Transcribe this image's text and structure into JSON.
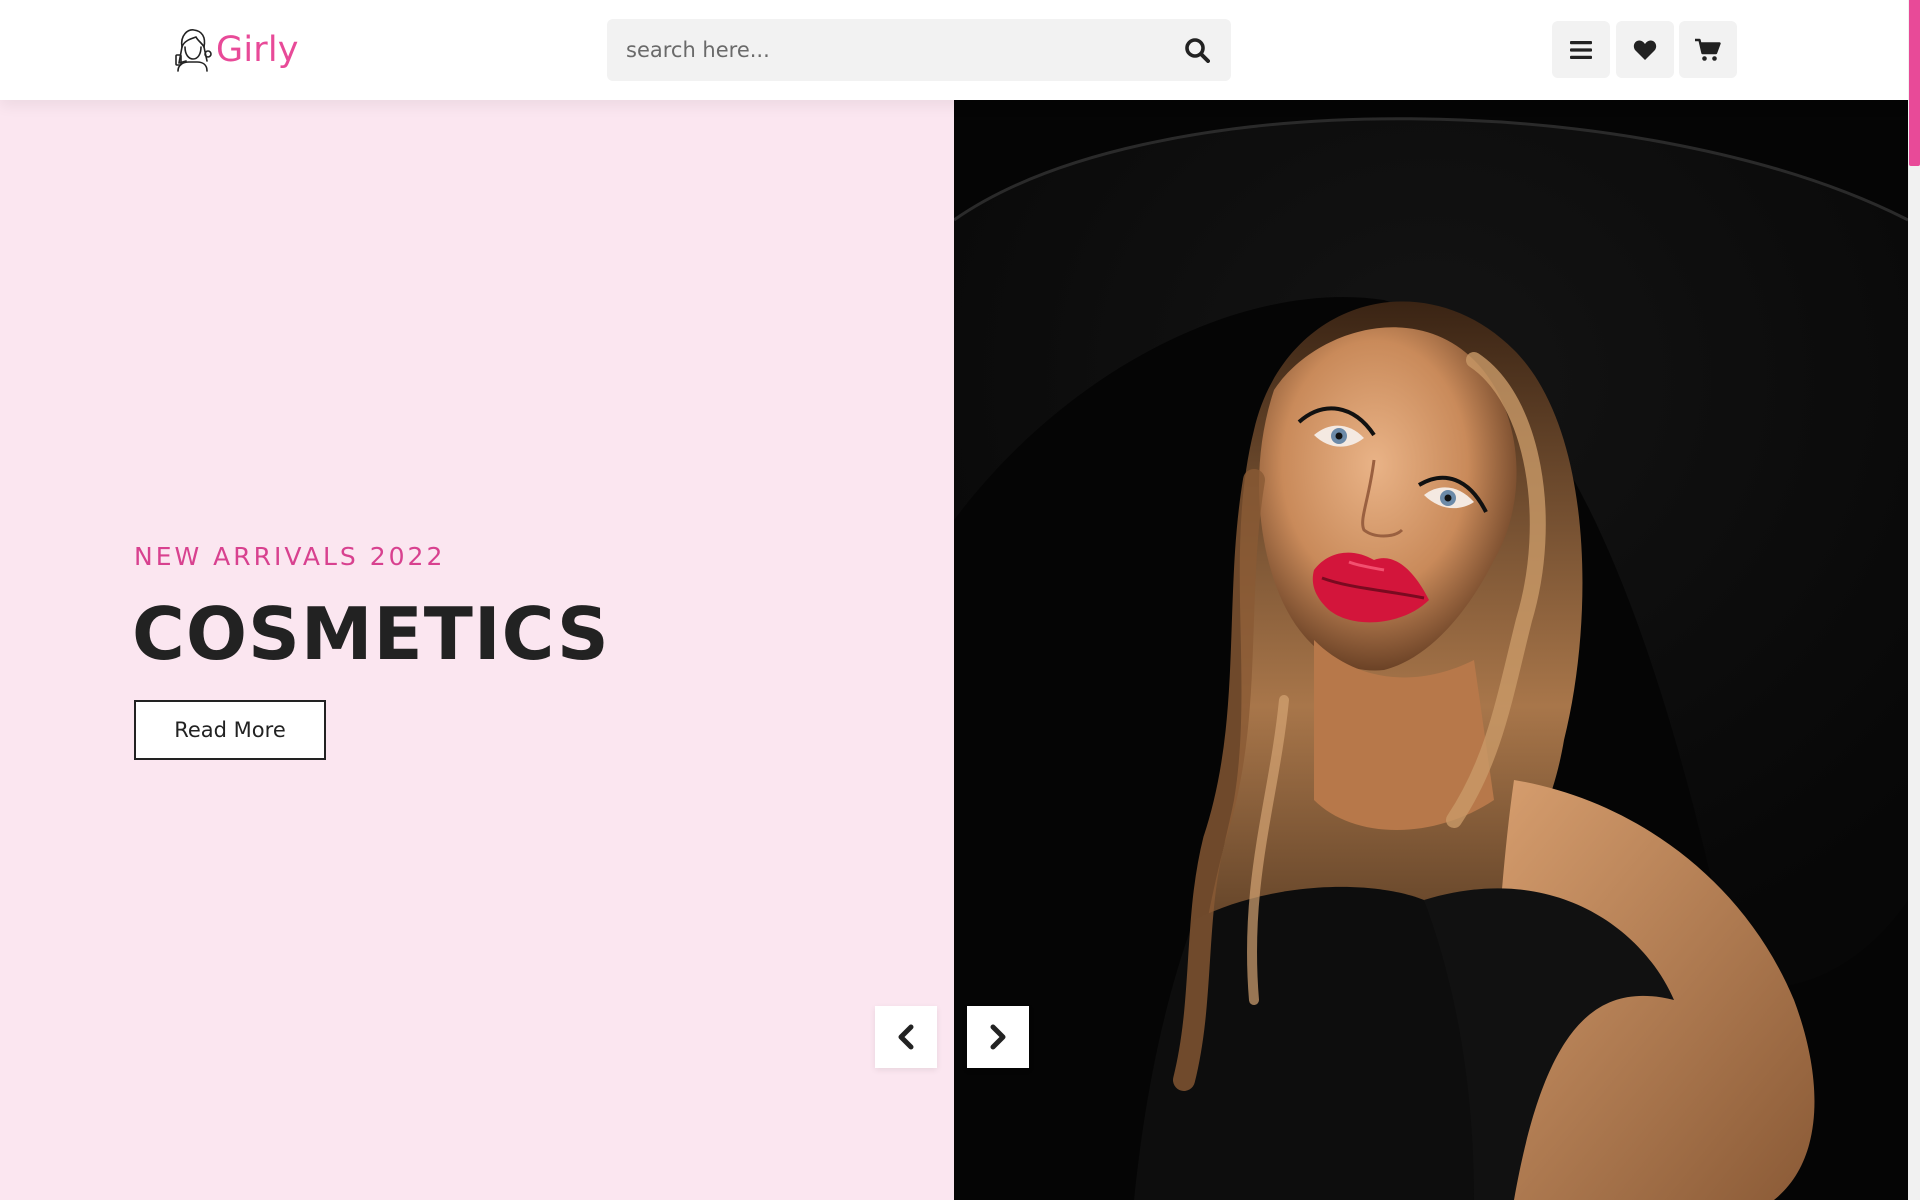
{
  "header": {
    "logo_text": "Girly",
    "search": {
      "placeholder": "search here..."
    },
    "icons": [
      "search-icon",
      "menu-icon",
      "heart-icon",
      "cart-icon"
    ]
  },
  "hero": {
    "eyebrow": "NEW ARRIVALS 2022",
    "title": "COSMETICS",
    "button_label": "Read More",
    "image": "woman-in-black-hat-photo",
    "nav": [
      "chevron-left-icon",
      "chevron-right-icon"
    ]
  },
  "colors": {
    "brand_pink": "#e84a98",
    "hero_background": "#fbe6f0",
    "text_dark": "#222222",
    "header_button_bg": "#f2f2f2"
  }
}
